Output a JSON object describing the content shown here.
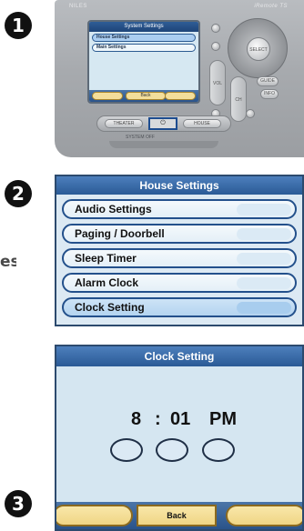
{
  "steps": {
    "one": "1",
    "two": "2",
    "three": "3"
  },
  "cropped_text": "es",
  "remote": {
    "brand": "NILES",
    "model": "iRemote TS",
    "screen": {
      "title": "System Settings",
      "items": [
        {
          "label": "House Settings"
        },
        {
          "label": "Main Settings"
        }
      ],
      "back_label": "Back"
    },
    "dpad_label": "SELECT",
    "vol_label": "VOL",
    "ch_label": "CH",
    "guide_label": "GUIDE",
    "info_label": "INFO",
    "theater_label": "THEATER",
    "power_symbol": "⏻",
    "house_label": "HOUSE",
    "system_off_label": "SYSTEM OFF"
  },
  "house_settings": {
    "title": "House Settings",
    "items": [
      {
        "label": "Audio Settings"
      },
      {
        "label": "Paging / Doorbell"
      },
      {
        "label": "Sleep Timer"
      },
      {
        "label": "Alarm Clock"
      },
      {
        "label": "Clock Setting"
      }
    ]
  },
  "clock_setting": {
    "title": "Clock Setting",
    "hour": "8",
    "separator": ":",
    "minute": "01",
    "ampm": "PM",
    "back_label": "Back"
  },
  "colors": {
    "title_bar": "#2a5a96",
    "panel_bg": "#d5e6f1",
    "button_gold": "#efd585",
    "border_blue": "#23508b"
  }
}
